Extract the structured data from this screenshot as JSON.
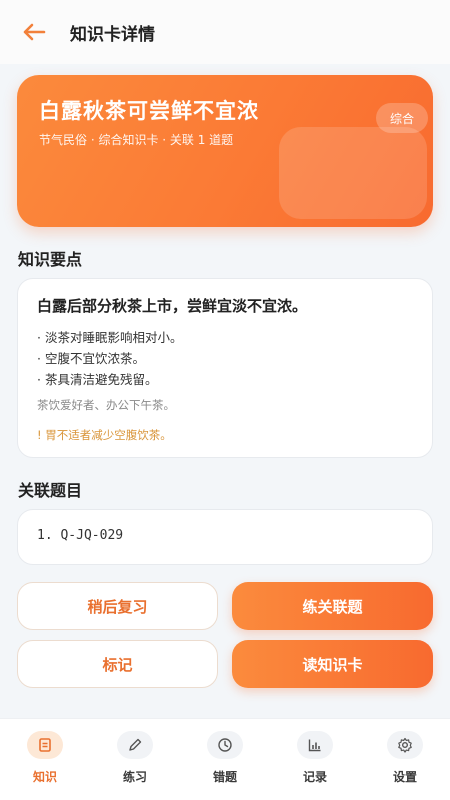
{
  "watermark": "61bb2d",
  "header": {
    "back_icon": "arrow-left-icon",
    "title": "知识卡详情"
  },
  "hero": {
    "title": "白露秋茶可尝鲜不宜浓",
    "subtitle": "节气民俗 · 综合知识卡 · 关联 1 道题",
    "badge": "综合"
  },
  "knowledge": {
    "section_title": "知识要点",
    "main_point": "白露后部分秋茶上市，尝鲜宜淡不宜浓。",
    "bullets": [
      "· 淡茶对睡眠影响相对小。",
      "· 空腹不宜饮浓茶。",
      "· 茶具清洁避免残留。"
    ],
    "audience": "茶饮爱好者、办公下午茶。",
    "warning": "! 胃不适者减少空腹饮茶。"
  },
  "related": {
    "section_title": "关联题目",
    "items": [
      "1. Q-JQ-029"
    ]
  },
  "actions": {
    "review_later": "稍后复习",
    "practice_related": "练关联题",
    "mark": "标记",
    "read_card": "读知识卡"
  },
  "tabbar": {
    "items": [
      {
        "label": "知识",
        "icon": "document-icon",
        "active": true
      },
      {
        "label": "练习",
        "icon": "pencil-icon",
        "active": false
      },
      {
        "label": "错题",
        "icon": "clock-icon",
        "active": false
      },
      {
        "label": "记录",
        "icon": "bar-chart-icon",
        "active": false
      },
      {
        "label": "设置",
        "icon": "gear-icon",
        "active": false
      }
    ]
  },
  "colors": {
    "accent": "#f86a2f",
    "accent_light": "#fb8a3c",
    "warning": "#d9953a"
  }
}
